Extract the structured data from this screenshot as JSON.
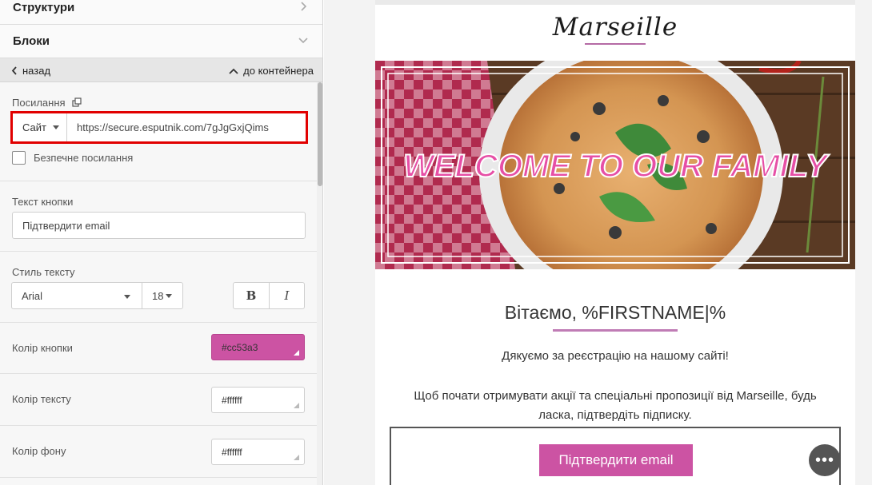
{
  "accordion": {
    "structures": "Структури",
    "blocks": "Блоки"
  },
  "nav": {
    "back": "назад",
    "to_container": "до контейнера"
  },
  "link": {
    "label": "Посилання",
    "type": "Сайт",
    "url": "https://secure.esputnik.com/7gJgGxjQims",
    "safe_link_label": "Безпечне посилання",
    "safe_link_checked": false
  },
  "button_text": {
    "label": "Текст кнопки",
    "value": "Підтвердити email"
  },
  "text_style": {
    "label": "Стиль тексту",
    "font": "Arial",
    "size": "18",
    "bold": "B",
    "italic": "I"
  },
  "button_color": {
    "label": "Колір кнопки",
    "value": "#cc53a3"
  },
  "text_color": {
    "label": "Колір тексту",
    "value": "#ffffff"
  },
  "bg_color": {
    "label": "Колір фону",
    "value": "#ffffff"
  },
  "email": {
    "logo": "Marseille",
    "banner_text": "WELCOME TO OUR FAMILY",
    "greeting": "Вітаємо, %FIRSTNAME|%",
    "thanks": "Дякуємо за реєстрацію на нашому сайті!",
    "body_line1": "Щоб почати отримувати акції та спеціальні пропозиції від Marseille, будь",
    "body_line2": "ласка, підтвердіть підписку.",
    "confirm_button": "Підтвердити email"
  },
  "more_button": "•••"
}
